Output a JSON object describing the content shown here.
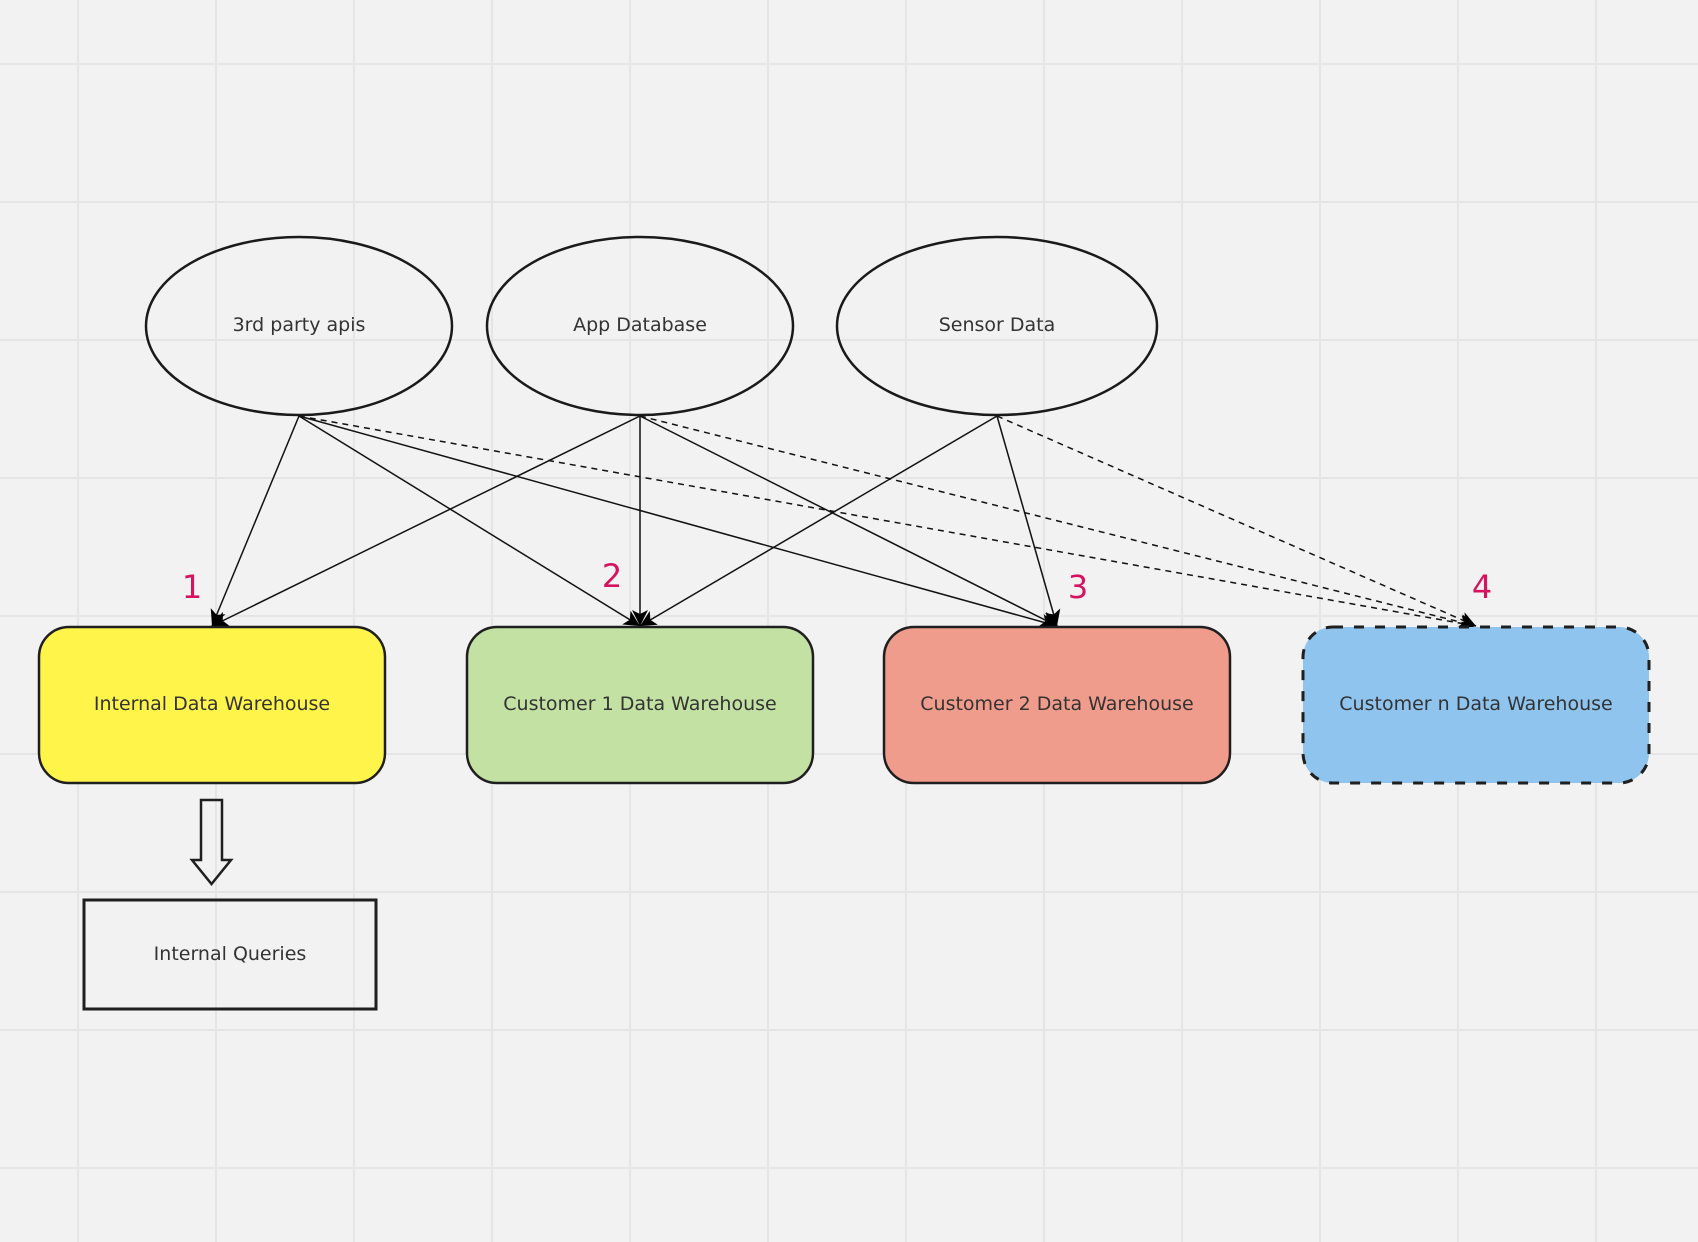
{
  "canvas": {
    "background": "#f2f2f2",
    "grid_color": "#e5e5e5"
  },
  "sources": [
    {
      "id": "src-3rd-party",
      "label": "3rd party apis"
    },
    {
      "id": "src-app-db",
      "label": "App Database"
    },
    {
      "id": "src-sensor",
      "label": "Sensor Data"
    }
  ],
  "warehouses": [
    {
      "id": "wh-internal",
      "label": "Internal Data Warehouse",
      "step": "1",
      "fill": "#fff44a",
      "border": "solid"
    },
    {
      "id": "wh-customer-1",
      "label": "Customer 1 Data Warehouse",
      "step": "2",
      "fill": "#c2e1a3",
      "border": "solid"
    },
    {
      "id": "wh-customer-2",
      "label": "Customer 2 Data Warehouse",
      "step": "3",
      "fill": "#f09c8c",
      "border": "solid"
    },
    {
      "id": "wh-customer-n",
      "label": "Customer n Data Warehouse",
      "step": "4",
      "fill": "#8fc4ee",
      "border": "dashed"
    }
  ],
  "step_label_color": "#d6135f",
  "connections": [
    {
      "from": "src-3rd-party",
      "to": "wh-internal",
      "style": "solid"
    },
    {
      "from": "src-3rd-party",
      "to": "wh-customer-1",
      "style": "solid"
    },
    {
      "from": "src-3rd-party",
      "to": "wh-customer-2",
      "style": "solid"
    },
    {
      "from": "src-3rd-party",
      "to": "wh-customer-n",
      "style": "dashed"
    },
    {
      "from": "src-app-db",
      "to": "wh-internal",
      "style": "solid"
    },
    {
      "from": "src-app-db",
      "to": "wh-customer-1",
      "style": "solid"
    },
    {
      "from": "src-app-db",
      "to": "wh-customer-2",
      "style": "solid"
    },
    {
      "from": "src-app-db",
      "to": "wh-customer-n",
      "style": "dashed"
    },
    {
      "from": "src-sensor",
      "to": "wh-customer-1",
      "style": "solid"
    },
    {
      "from": "src-sensor",
      "to": "wh-customer-2",
      "style": "solid"
    },
    {
      "from": "src-sensor",
      "to": "wh-customer-n",
      "style": "dashed"
    }
  ],
  "downstream": {
    "from": "wh-internal",
    "label": "Internal Queries",
    "arrow_icon": "block-arrow-down-icon"
  }
}
